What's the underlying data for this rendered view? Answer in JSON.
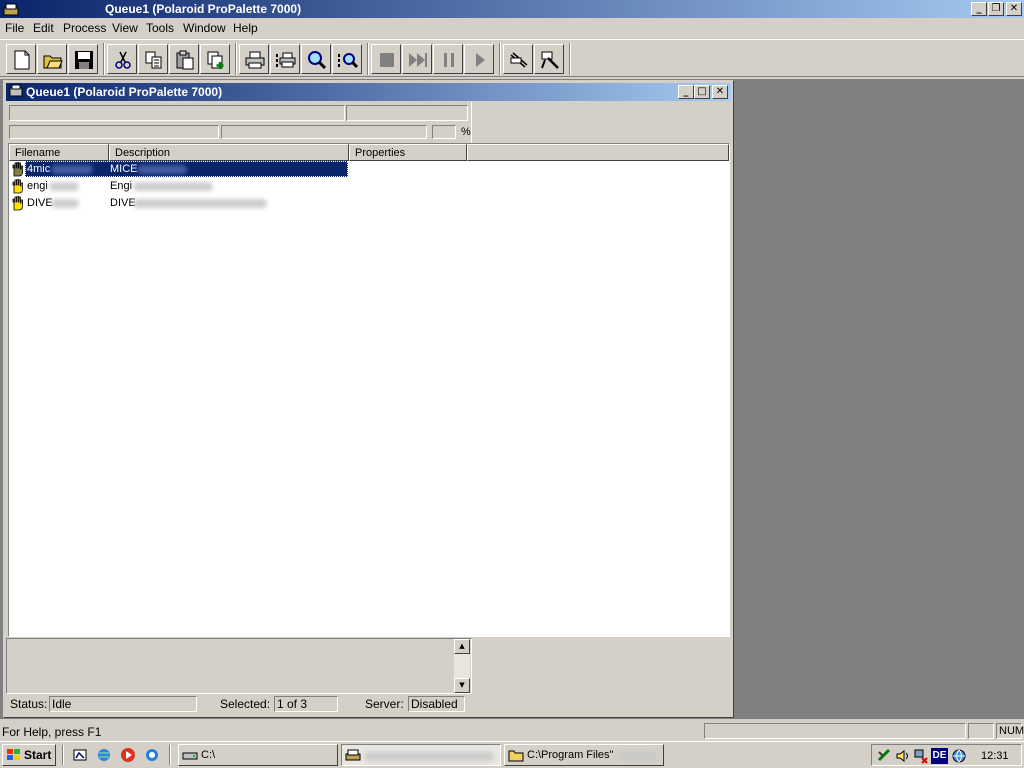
{
  "app": {
    "title": "Queue1 (Polaroid ProPalette 7000)"
  },
  "menu": {
    "file": "File",
    "edit": "Edit",
    "process": "Process",
    "view": "View",
    "tools": "Tools",
    "window": "Window",
    "help": "Help"
  },
  "toolbar": {
    "icons": [
      "new-file-icon",
      "open-folder-icon",
      "save-icon",
      "cut-icon",
      "copy-icon",
      "paste-icon",
      "paste-new-icon",
      "print-icon",
      "print-small-icon",
      "zoom-icon",
      "zoom-preview-icon",
      "stop-icon",
      "fast-forward-icon",
      "pause-icon",
      "play-icon",
      "settings-icon",
      "tools-icon"
    ]
  },
  "child": {
    "title": "Queue1 (Polaroid ProPalette 7000)",
    "percent_label": "%"
  },
  "list": {
    "columns": [
      "Filename",
      "Description",
      "Properties"
    ],
    "rows": [
      {
        "filename": "4mic",
        "description": "MICE",
        "selected": true
      },
      {
        "filename": "engi",
        "description": "Engi",
        "selected": false
      },
      {
        "filename": "DIVE",
        "description": "DIVE",
        "selected": false
      }
    ]
  },
  "status": {
    "status_label": "Status:",
    "status_value": "Idle",
    "selected_label": "Selected:",
    "selected_value": "1 of 3",
    "server_label": "Server:",
    "server_value": "Disabled"
  },
  "mainstatus": {
    "help_text": "For Help, press F1",
    "num": "NUM"
  },
  "taskbar": {
    "start": "Start",
    "tasks": [
      "C:\\",
      "",
      "C:\\Program Files\""
    ],
    "tray_lang": "DE",
    "clock": "12:31"
  },
  "colors": {
    "title_start": "#0a246a",
    "title_end": "#a6caf0",
    "face": "#d4d0c8",
    "mdi_bg": "#808080"
  }
}
